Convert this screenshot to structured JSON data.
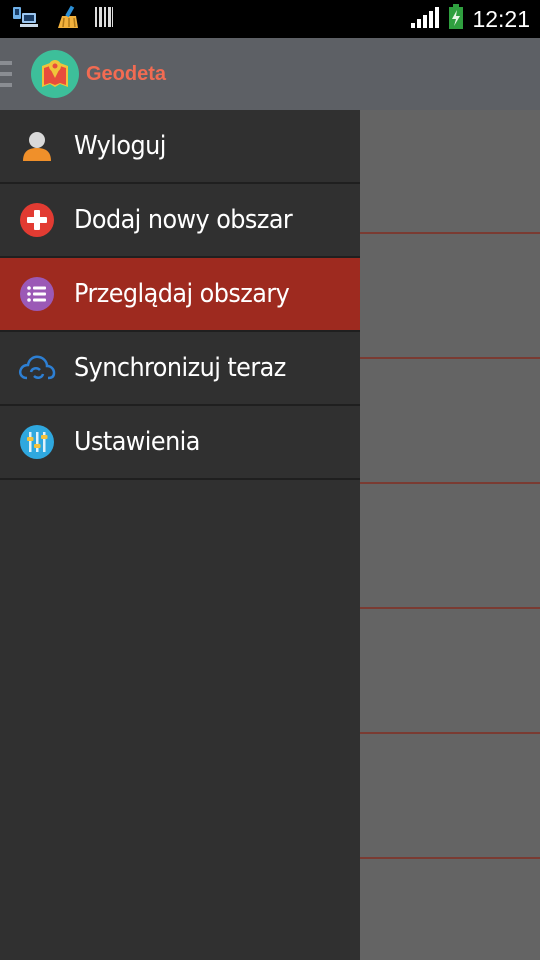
{
  "status_bar": {
    "time": "12:21",
    "icons": [
      "usb-debug-icon",
      "clean-master-icon",
      "barcode-icon",
      "signal-icon",
      "battery-charging-icon"
    ]
  },
  "action_bar": {
    "app_title": "Geodeta",
    "menu_toggle_icon": "drawer-menu-icon",
    "logo_icon": "map-pin-book-icon"
  },
  "drawer": {
    "items": [
      {
        "label": "Wyloguj",
        "icon": "user-icon",
        "active": false
      },
      {
        "label": "Dodaj nowy obszar",
        "icon": "add-circle-icon",
        "active": false
      },
      {
        "label": "Przeglądaj obszary",
        "icon": "list-icon",
        "active": true
      },
      {
        "label": "Synchronizuj teraz",
        "icon": "cloud-sync-icon",
        "active": false
      },
      {
        "label": "Ustawienia",
        "icon": "sliders-icon",
        "active": false
      }
    ]
  },
  "colors": {
    "active_item": "#9e2a1f",
    "drawer_bg": "#303030",
    "action_bar": "#5d6065",
    "app_title": "#f26b52",
    "logo_bg": "#3dbf9a"
  }
}
